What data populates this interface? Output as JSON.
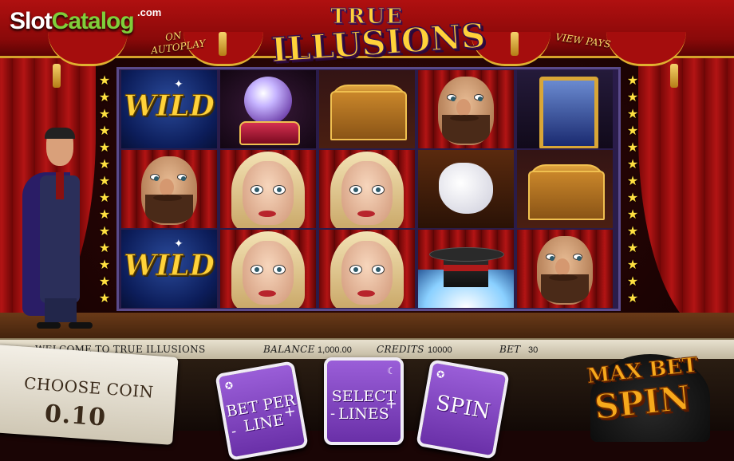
{
  "site": {
    "logo_a": "Slot",
    "logo_b": "Catalog",
    "logo_tld": ".com"
  },
  "header": {
    "autoplay_label": "AUTOPLAY",
    "autoplay_prefix": "ON",
    "view_pays_label": "VIEW PAYS",
    "game_title_top": "TRUE",
    "game_title_bottom": "ILLUSIONS"
  },
  "reels": {
    "rows": [
      [
        "wild",
        "crystal-ball",
        "treasure-chest",
        "bearded-man",
        "magic-mirror"
      ],
      [
        "bearded-man",
        "blonde-woman",
        "blonde-woman",
        "white-glove",
        "treasure-chest"
      ],
      [
        "wild",
        "blonde-woman",
        "blonde-woman",
        "top-hat",
        "bearded-man"
      ]
    ],
    "wild_text": "WILD"
  },
  "info_bar": {
    "welcome": "WELCOME TO TRUE ILLUSIONS",
    "balance_label": "BALANCE",
    "balance_value": "1,000.00",
    "credits_label": "CREDITS",
    "credits_value": "10000",
    "bet_label": "BET",
    "bet_value": "30"
  },
  "controls": {
    "choose_coin_label": "CHOOSE COIN",
    "coin_value": "0.10",
    "bet_per_line_l1": "BET PER",
    "bet_per_line_l2": "LINE",
    "select_lines_l1": "SELECT",
    "select_lines_l2": "LINES",
    "spin_label": "SPIN",
    "max_bet_label": "MAX BET",
    "max_spin_label": "SPIN",
    "minus": "-",
    "plus": "+"
  },
  "colors": {
    "gold": "#ffd23a",
    "card_purple": "#8a4fd0",
    "curtain_red": "#b31414",
    "max_bet_orange": "#f7a91c"
  }
}
